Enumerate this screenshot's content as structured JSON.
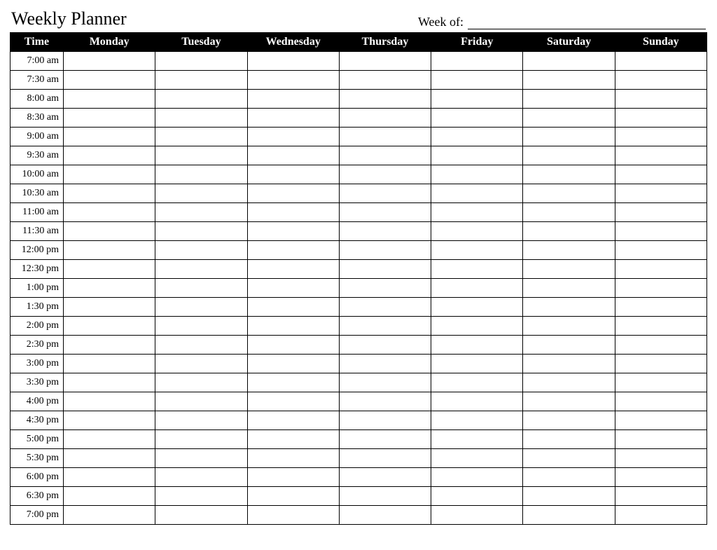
{
  "header": {
    "title": "Weekly Planner",
    "week_of_label": "Week of:",
    "week_of_value": ""
  },
  "table": {
    "columns": [
      "Time",
      "Monday",
      "Tuesday",
      "Wednesday",
      "Thursday",
      "Friday",
      "Saturday",
      "Sunday"
    ],
    "times": [
      "7:00 am",
      "7:30 am",
      "8:00 am",
      "8:30 am",
      "9:00 am",
      "9:30 am",
      "10:00 am",
      "10:30 am",
      "11:00 am",
      "11:30 am",
      "12:00 pm",
      "12:30 pm",
      "1:00 pm",
      "1:30 pm",
      "2:00 pm",
      "2:30 pm",
      "3:00 pm",
      "3:30 pm",
      "4:00 pm",
      "4:30 pm",
      "5:00 pm",
      "5:30 pm",
      "6:00 pm",
      "6:30 pm",
      "7:00 pm"
    ]
  }
}
